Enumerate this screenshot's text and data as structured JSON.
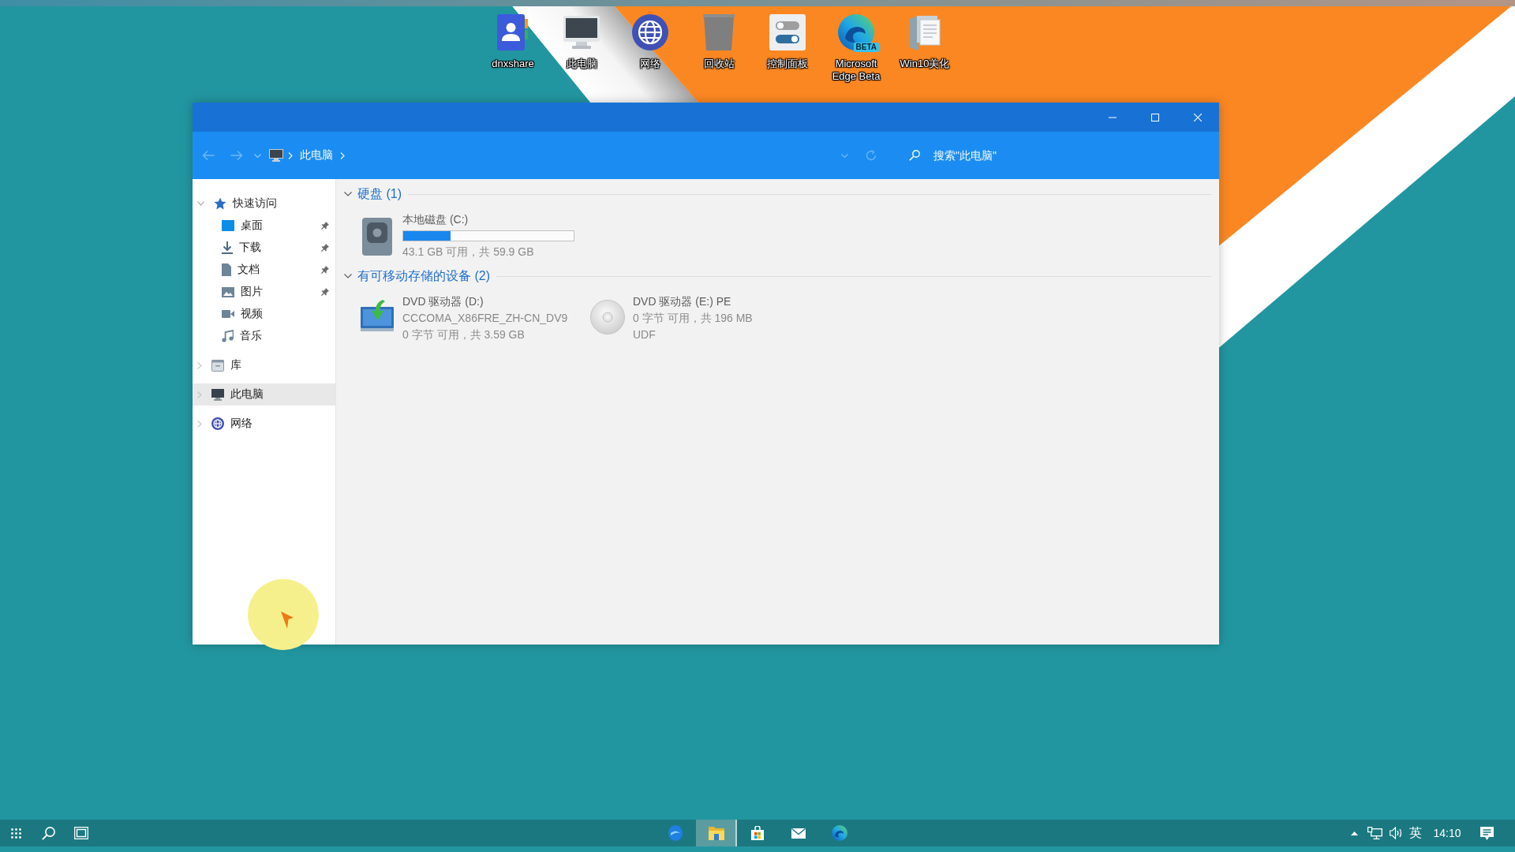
{
  "desktop": {
    "icons": [
      {
        "label": "dnxshare",
        "kind": "contact"
      },
      {
        "label": "此电脑",
        "kind": "computer"
      },
      {
        "label": "网络",
        "kind": "network"
      },
      {
        "label": "回收站",
        "kind": "recycle-bin"
      },
      {
        "label": "控制面板",
        "kind": "control-panel"
      },
      {
        "label": "Microsoft Edge Beta",
        "kind": "browser",
        "badge": "BETA"
      },
      {
        "label": "Win10美化",
        "kind": "documents"
      }
    ]
  },
  "window": {
    "address": {
      "path": [
        "此电脑"
      ],
      "search": {
        "placeholder": "搜索\"此电脑\""
      }
    },
    "sidebar": {
      "items": [
        {
          "label": "快速访问",
          "kind": "star",
          "expanded": true,
          "selected": false,
          "children": [
            {
              "label": "桌面",
              "kind": "desktop",
              "pinned": true,
              "selected": false
            },
            {
              "label": "下载",
              "kind": "download",
              "pinned": true,
              "selected": false
            },
            {
              "label": "文档",
              "kind": "document",
              "pinned": true,
              "selected": false
            },
            {
              "label": "图片",
              "kind": "pictures",
              "pinned": true,
              "selected": false
            },
            {
              "label": "视频",
              "kind": "videos",
              "pinned": false,
              "selected": false
            },
            {
              "label": "音乐",
              "kind": "music",
              "pinned": false,
              "selected": false
            }
          ]
        },
        {
          "label": "库",
          "kind": "library",
          "expanded": false,
          "selected": false
        },
        {
          "label": "此电脑",
          "kind": "computer",
          "expanded": false,
          "selected": true
        },
        {
          "label": "网络",
          "kind": "network",
          "expanded": false,
          "selected": false
        }
      ]
    },
    "content": {
      "groups": [
        {
          "title": "硬盘 (1)",
          "expanded": true,
          "drives": [
            {
              "kind": "disk",
              "name": "本地磁盘 (C:)",
              "level": 0.28,
              "lines": [
                "43.1 GB 可用，共 59.9 GB"
              ]
            }
          ]
        },
        {
          "title": "有可移动存储的设备 (2)",
          "expanded": true,
          "drives": [
            {
              "kind": "dvd-setup",
              "name": "DVD 驱动器 (D:)",
              "lines": [
                "CCCOMA_X86FRE_ZH-CN_DV9",
                "0 字节 可用，共 3.59 GB"
              ]
            },
            {
              "kind": "disc",
              "name": "DVD 驱动器 (E:) PE",
              "lines": [
                "0 字节 可用，共 196 MB",
                "UDF"
              ]
            }
          ]
        }
      ]
    }
  },
  "taskbar": {
    "apps": [
      {
        "kind": "browser-legacy",
        "selected": false
      },
      {
        "kind": "file-explorer",
        "selected": true
      },
      {
        "kind": "store",
        "selected": false
      },
      {
        "kind": "mail",
        "selected": false
      },
      {
        "kind": "browser-beta",
        "selected": false
      }
    ],
    "tray": {
      "input_method": "英",
      "time": "14:10"
    }
  }
}
